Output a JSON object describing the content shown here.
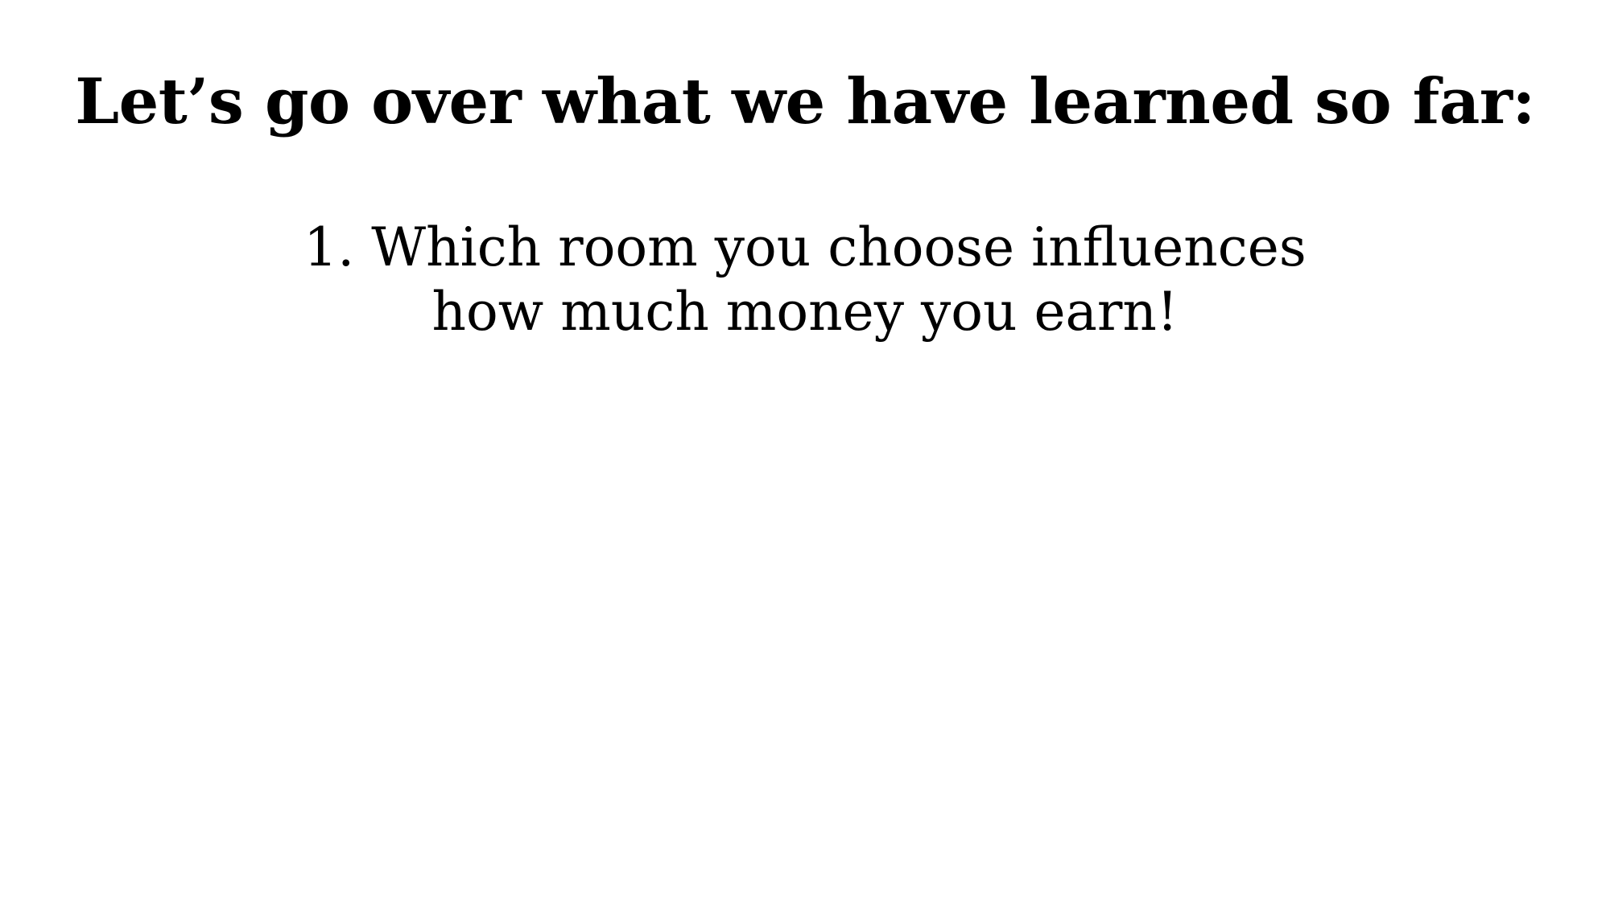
{
  "slide": {
    "title": "Let’s go over what we have learned so far:",
    "points": [
      {
        "line1": "1. Which room you choose influences",
        "line2": "how much money you earn!"
      }
    ]
  }
}
